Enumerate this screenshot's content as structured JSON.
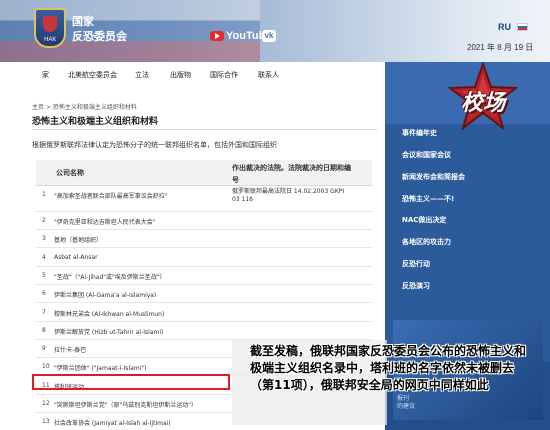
{
  "header": {
    "org_line1": "国家",
    "org_line2": "反恐委员会",
    "emblem_text": "НАК",
    "youtube_label": "YouTube",
    "vk_label": "vk",
    "lang": "RU",
    "date": "2021 年 8 月 19 日"
  },
  "nav": {
    "items": [
      "家",
      "北美航空委员会",
      "立法",
      "出版物",
      "国际合作",
      "联系人"
    ]
  },
  "breadcrumb": "主页 > 恐怖主义和极端主义组织和材料",
  "page_title": "恐怖主义和极端主义组织和材料",
  "intro": "根据俄罗斯联邦法律认定为恐怖分子的统一联邦组织名单，包括外国和国际组织",
  "table": {
    "col_name": "公司名称",
    "col_decision_1": "作出裁决的法院。法院裁决的日期和编",
    "col_decision_2": "号",
    "rows": [
      {
        "num": "1",
        "name": "\"高加索圣战者联合部队最高军事议会舒拉\"",
        "decision_1": "俄罗斯联邦最高法院日 14.02.2003 GKPI",
        "decision_2": "03 116"
      },
      {
        "num": "2",
        "name": "\"伊奇克里亚和达吉斯坦人民代表大会\"",
        "decision_1": "",
        "decision_2": ""
      },
      {
        "num": "3",
        "name": "基地（基地组织）",
        "decision_1": "",
        "decision_2": ""
      },
      {
        "num": "4",
        "name": "Asbat al-Ansar",
        "decision_1": "",
        "decision_2": ""
      },
      {
        "num": "5",
        "name": "\"圣战\"（\"Al-Jihad\"或\"埃及伊斯兰圣战\"）",
        "decision_1": "",
        "decision_2": ""
      },
      {
        "num": "6",
        "name": "伊斯兰集团 (Al-Gama'a al-Islamiya)",
        "decision_1": "",
        "decision_2": ""
      },
      {
        "num": "7",
        "name": "穆斯林兄弟会 (Al-Ikhwan al-Muslimun)",
        "decision_1": "",
        "decision_2": ""
      },
      {
        "num": "8",
        "name": "伊斯兰解放党 (Hizb ut-Tahrir al-Islami)",
        "decision_1": "",
        "decision_2": ""
      },
      {
        "num": "9",
        "name": "拉什卡-泰巴",
        "decision_1": "",
        "decision_2": ""
      },
      {
        "num": "10",
        "name": "\"伊斯兰团体\" (\"Jamaat-i-Islami\")",
        "decision_1": "",
        "decision_2": ""
      },
      {
        "num": "11",
        "name": "塔利班运动",
        "decision_1": "",
        "decision_2": ""
      },
      {
        "num": "12",
        "name": "\"突厥斯坦伊斯兰党\"（原\"乌兹别克斯坦伊斯兰运动\"）",
        "decision_1": "",
        "decision_2": ""
      },
      {
        "num": "13",
        "name": "社会改革协会 (Jamiyat al-Islah al-Ijtimai)",
        "decision_1": "",
        "decision_2": ""
      }
    ]
  },
  "sidebar": {
    "badge_text": "校场",
    "links": [
      "事件编年史",
      "会议和国家会议",
      "新闻发布会和简报会",
      "恐怖主义——不!",
      "NAC做出决定",
      "各地区的攻击力",
      "反恐行动",
      "反恐演习"
    ],
    "img_text_1": "报刊",
    "img_text_2": "的建议"
  },
  "caption": "截至发稿，俄联邦国家反恐委员会公布的恐怖主义和极端主义组织名录中，塔利班的名字依然未被删去（第11项），俄联邦安全局的网页中同样如此",
  "colors": {
    "highlight": "#e11b22",
    "sidebar_blue": "#2b5b9b",
    "header_blue": "#6d8fb8"
  }
}
